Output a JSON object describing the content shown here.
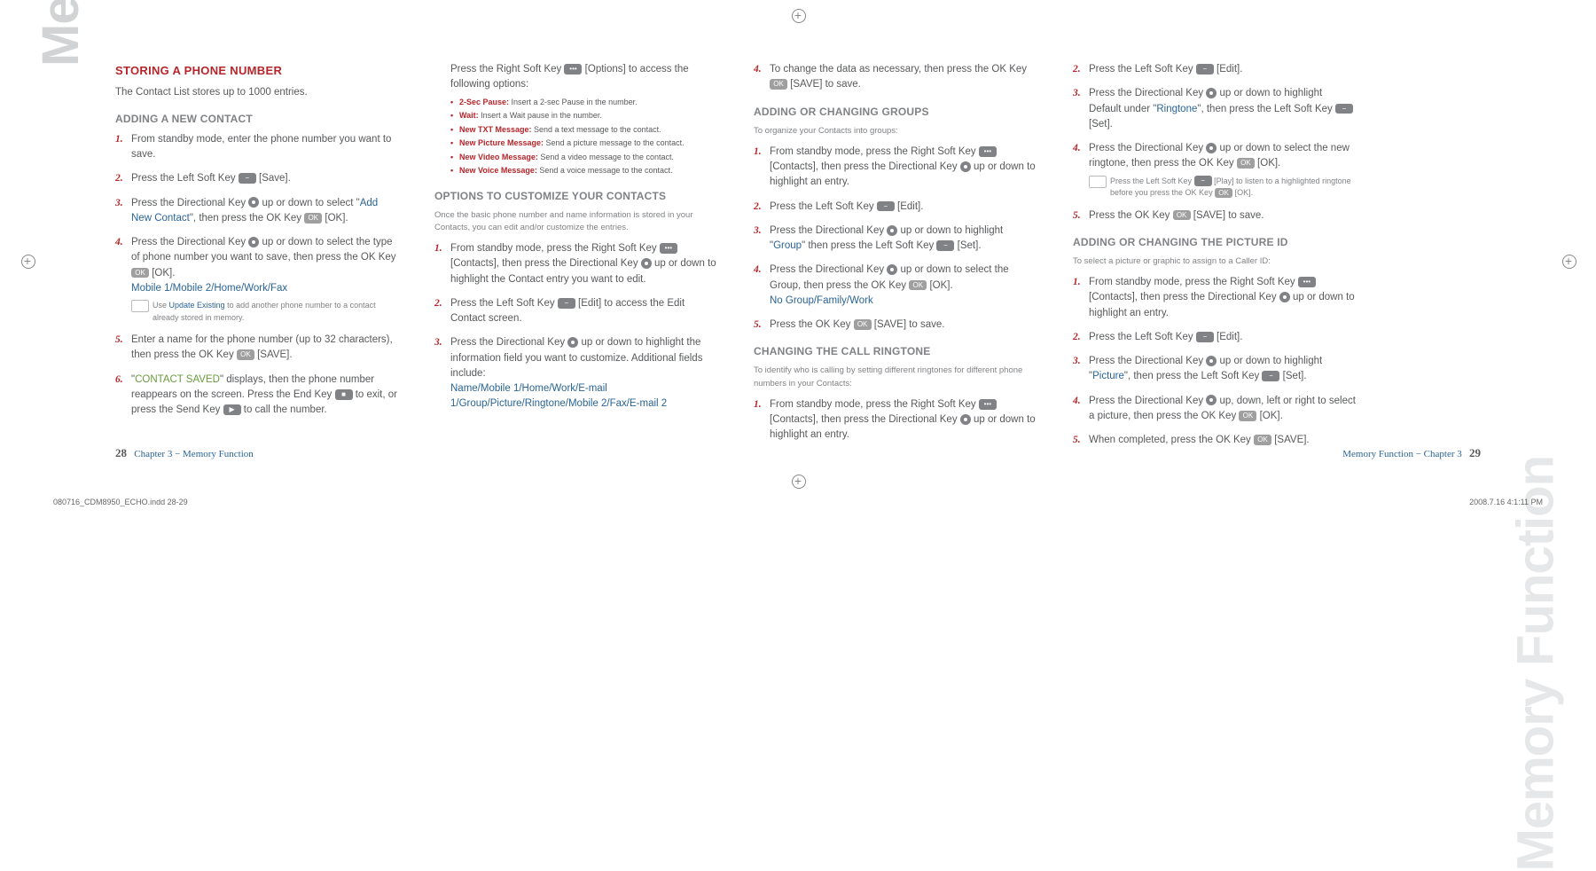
{
  "sideTab": "Memory Function",
  "c1": {
    "h1": "STORING A PHONE NUMBER",
    "intro": "The Contact List stores up to 1000 entries.",
    "h2a": "ADDING A NEW CONTACT",
    "s1": "From standby mode, enter the phone number you want to save.",
    "s2a": "Press the Left Soft Key ",
    "s2b": " [Save].",
    "s3a": "Press the Directional Key ",
    "s3b": " up or down to select \"",
    "s3c": "Add New Contact",
    "s3d": "\", then press the OK Key ",
    "s3e": " [OK].",
    "s4a": "Press the Directional Key ",
    "s4b": " up or down to select the type of phone number you want to save, then press the OK Key ",
    "s4c": " [OK].",
    "s4opts": "Mobile 1/Mobile 2/Home/Work/Fax",
    "note1a": "Use ",
    "note1b": "Update Existing",
    "note1c": " to add another phone number to a contact already stored in memory.",
    "s5a": "Enter a name for the phone number (up to 32 characters), then press the OK Key ",
    "s5b": " [SAVE].",
    "s6a": "\"",
    "s6b": "CONTACT SAVED",
    "s6c": "\" displays, then the phone number reappears on the screen. Press the End Key ",
    "s6d": " to exit, or press the Send Key ",
    "s6e": " to call the number."
  },
  "c2": {
    "topA": "Press the Right Soft Key ",
    "topB": " [Options] to access the following options:",
    "o1": "2-Sec Pause:",
    "o1t": " Insert a 2-sec Pause in the number.",
    "o2": "Wait:",
    "o2t": " Insert a Wait pause in the number.",
    "o3": "New TXT Message:",
    "o3t": " Send a text message to the contact.",
    "o4": "New Picture Message:",
    "o4t": " Send a picture message to the contact.",
    "o5": "New Video Message:",
    "o5t": " Send a video message to the contact.",
    "o6": "New Voice Message:",
    "o6t": " Send a voice message to the contact.",
    "h2": "OPTIONS TO CUSTOMIZE YOUR CONTACTS",
    "sub": "Once the basic phone number and name information is stored in your Contacts, you can edit and/or customize the entries.",
    "s1a": "From standby mode, press the Right Soft Key ",
    "s1b": " [Contacts], then press the Directional Key ",
    "s1c": " up or down to highlight the Contact entry you want to edit.",
    "s2a": "Press the Left Soft Key ",
    "s2b": " [Edit] to access the Edit Contact screen.",
    "s3a": "Press the Directional Key ",
    "s3b": " up or down to highlight the information field you want to customize. Additional fields include: ",
    "s3opts": "Name/Mobile 1/Home/Work/E-mail 1/Group/Picture/Ringtone/Mobile 2/Fax/E-mail 2"
  },
  "c3": {
    "s4a": "To change the data as necessary, then press the OK Key ",
    "s4b": " [SAVE] to save.",
    "h2a": "ADDING OR CHANGING GROUPS",
    "suba": "To organize your Contacts into groups:",
    "g1a": "From standby mode, press the Right Soft Key ",
    "g1b": " [Contacts], then press the Directional Key ",
    "g1c": " up or down to highlight an entry.",
    "g2a": "Press the Left Soft Key ",
    "g2b": " [Edit].",
    "g3a": "Press the Directional Key ",
    "g3b": " up or down to highlight \"",
    "g3c": "Group",
    "g3d": "\" then press the Left Soft Key ",
    "g3e": " [Set].",
    "g4a": "Press the Directional Key ",
    "g4b": " up or down to select the Group, then press the OK Key ",
    "g4c": " [OK].",
    "g4opts": "No Group/Family/Work",
    "g5a": "Press the OK Key ",
    "g5b": " [SAVE] to save.",
    "h2b": "CHANGING THE CALL RINGTONE",
    "subb": "To identify who is calling by setting different ringtones for different phone numbers in your Contacts:",
    "r1a": "From standby mode, press the Right Soft Key ",
    "r1b": " [Contacts], then press the Directional Key ",
    "r1c": " up or down to highlight an entry."
  },
  "c4": {
    "r2a": "Press the Left Soft Key ",
    "r2b": " [Edit].",
    "r3a": "Press the Directional Key ",
    "r3b": " up or down to highlight Default under \"",
    "r3c": "Ringtone",
    "r3d": "\", then press the Left Soft Key ",
    "r3e": " [Set].",
    "r4a": "Press the Directional Key ",
    "r4b": " up or down to select the new ringtone, then press the OK Key ",
    "r4c": " [OK].",
    "note2a": "Press the Left Soft Key ",
    "note2b": " [Play] to listen to a highlighted ringtone before you press the OK Key ",
    "note2c": " [OK].",
    "r5a": "Press the OK Key ",
    "r5b": " [SAVE] to save.",
    "h2": "ADDING OR CHANGING THE PICTURE ID",
    "sub": "To select a picture or graphic to assign to a Caller ID:",
    "p1a": "From standby mode, press the Right Soft Key ",
    "p1b": " [Contacts], then press the Directional Key ",
    "p1c": " up or down to highlight an entry.",
    "p2a": "Press the Left Soft Key ",
    "p2b": " [Edit].",
    "p3a": "Press the Directional Key ",
    "p3b": " up or down to highlight \"",
    "p3c": "Picture",
    "p3d": "\", then press the Left Soft Key ",
    "p3e": " [Set].",
    "p4a": "Press the Directional Key ",
    "p4b": " up, down, left or right to select a picture, then press the OK Key ",
    "p4c": " [OK].",
    "p5a": "When completed, press the OK Key ",
    "p5b": " [SAVE]."
  },
  "footerL": {
    "pn": "28",
    "ch": "Chapter 3 − Memory Function"
  },
  "footerR": {
    "ch": "Memory Function − Chapter 3",
    "pn": "29"
  },
  "metaL": "080716_CDM8950_ECHO.indd   28-29",
  "metaR": "2008.7.16   4:1:11 PM",
  "keys": {
    "ok": "OK",
    "dots": "•••",
    "dash": "−",
    "send": "▶",
    "end": "■"
  }
}
